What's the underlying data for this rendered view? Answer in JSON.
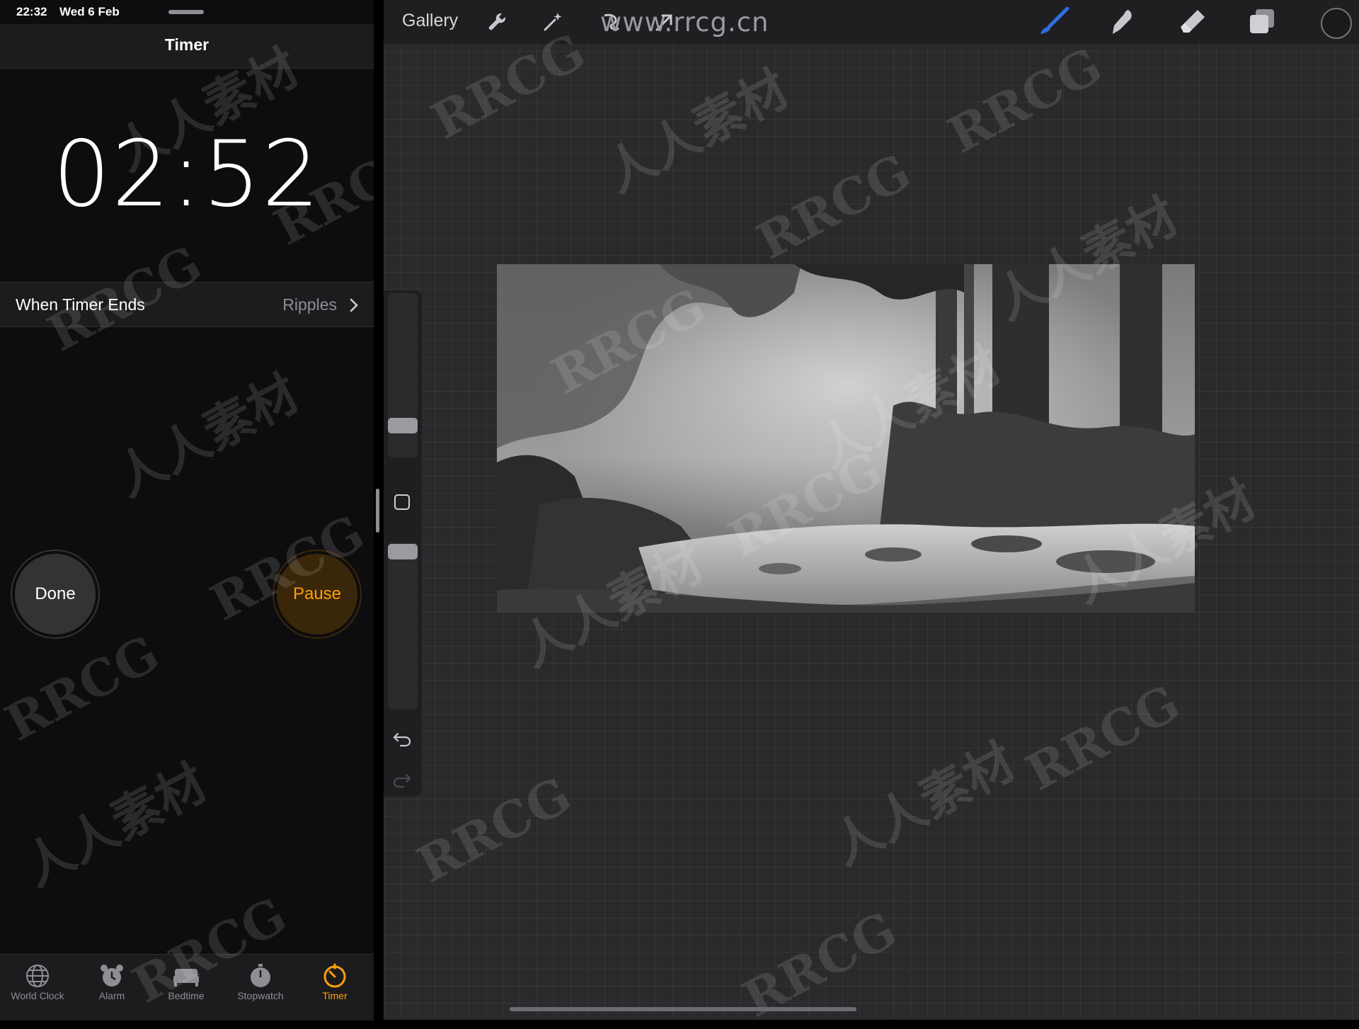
{
  "status_bar": {
    "time": "22:32",
    "date": "Wed 6 Feb"
  },
  "clock_app": {
    "title": "Timer",
    "countdown": "02:52",
    "when_timer_ends": {
      "label": "When Timer Ends",
      "value": "Ripples"
    },
    "done_label": "Done",
    "pause_label": "Pause",
    "tabs": [
      {
        "label": "World Clock",
        "icon": "globe-icon",
        "active": false
      },
      {
        "label": "Alarm",
        "icon": "alarm-clock-icon",
        "active": false
      },
      {
        "label": "Bedtime",
        "icon": "bed-icon",
        "active": false
      },
      {
        "label": "Stopwatch",
        "icon": "stopwatch-icon",
        "active": false
      },
      {
        "label": "Timer",
        "icon": "timer-icon",
        "active": true
      }
    ],
    "accent_color": "#ff9f0a"
  },
  "procreate": {
    "gallery_label": "Gallery",
    "toolbar_icons": [
      "wrench-icon",
      "magic-wand-icon",
      "selection-icon",
      "transform-arrow-icon",
      "brush-icon",
      "smudge-icon",
      "eraser-icon",
      "layers-icon"
    ],
    "active_tool": "brush-icon",
    "active_tool_color": "#2f6fe0",
    "side_icons": [
      "brush-size-slider",
      "modify-button",
      "opacity-slider",
      "undo-icon",
      "redo-icon"
    ]
  },
  "watermarks": {
    "url": "www.rrcg.cn",
    "text_a": "RRCG",
    "text_b": "人人素材"
  }
}
